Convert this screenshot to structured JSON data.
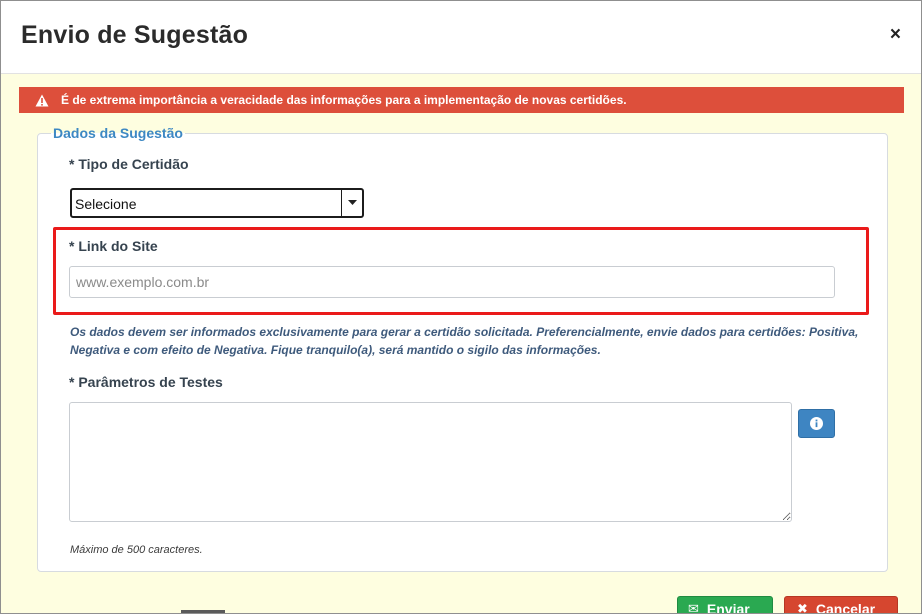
{
  "dialog": {
    "title": "Envio de Sugestão",
    "close_symbol": "×"
  },
  "alert": {
    "icon": "warning-triangle-icon",
    "text": "É de extrema importância a veracidade das informações para a implementação de novas certidões.",
    "color": "#dd4f3b"
  },
  "form": {
    "legend": "Dados da Sugestão",
    "tipo_certidao": {
      "label": "* Tipo de Certidão",
      "selected": "Selecione"
    },
    "link_site": {
      "label": "* Link do Site",
      "placeholder": "www.exemplo.com.br",
      "value": ""
    },
    "help_text": "Os dados devem ser informados exclusivamente para gerar a certidão solicitada. Preferencialmente, envie dados para certidões: Positiva, Negativa e com efeito de Negativa. Fique tranquilo(a), será mantido o sigilo das informações.",
    "parametros": {
      "label": "* Parâmetros de Testes",
      "value": "",
      "info_icon": "info-icon",
      "max_chars_note": "Máximo de 500 caracteres."
    }
  },
  "footer": {
    "enviar_label": "Enviar",
    "cancelar_label": "Cancelar",
    "enviar_color": "#2aa951",
    "cancelar_color": "#d6462f"
  },
  "colors": {
    "highlight": "#ea1a1a",
    "accent": "#3d88c3",
    "modal_body_bg": "#fefee0"
  }
}
